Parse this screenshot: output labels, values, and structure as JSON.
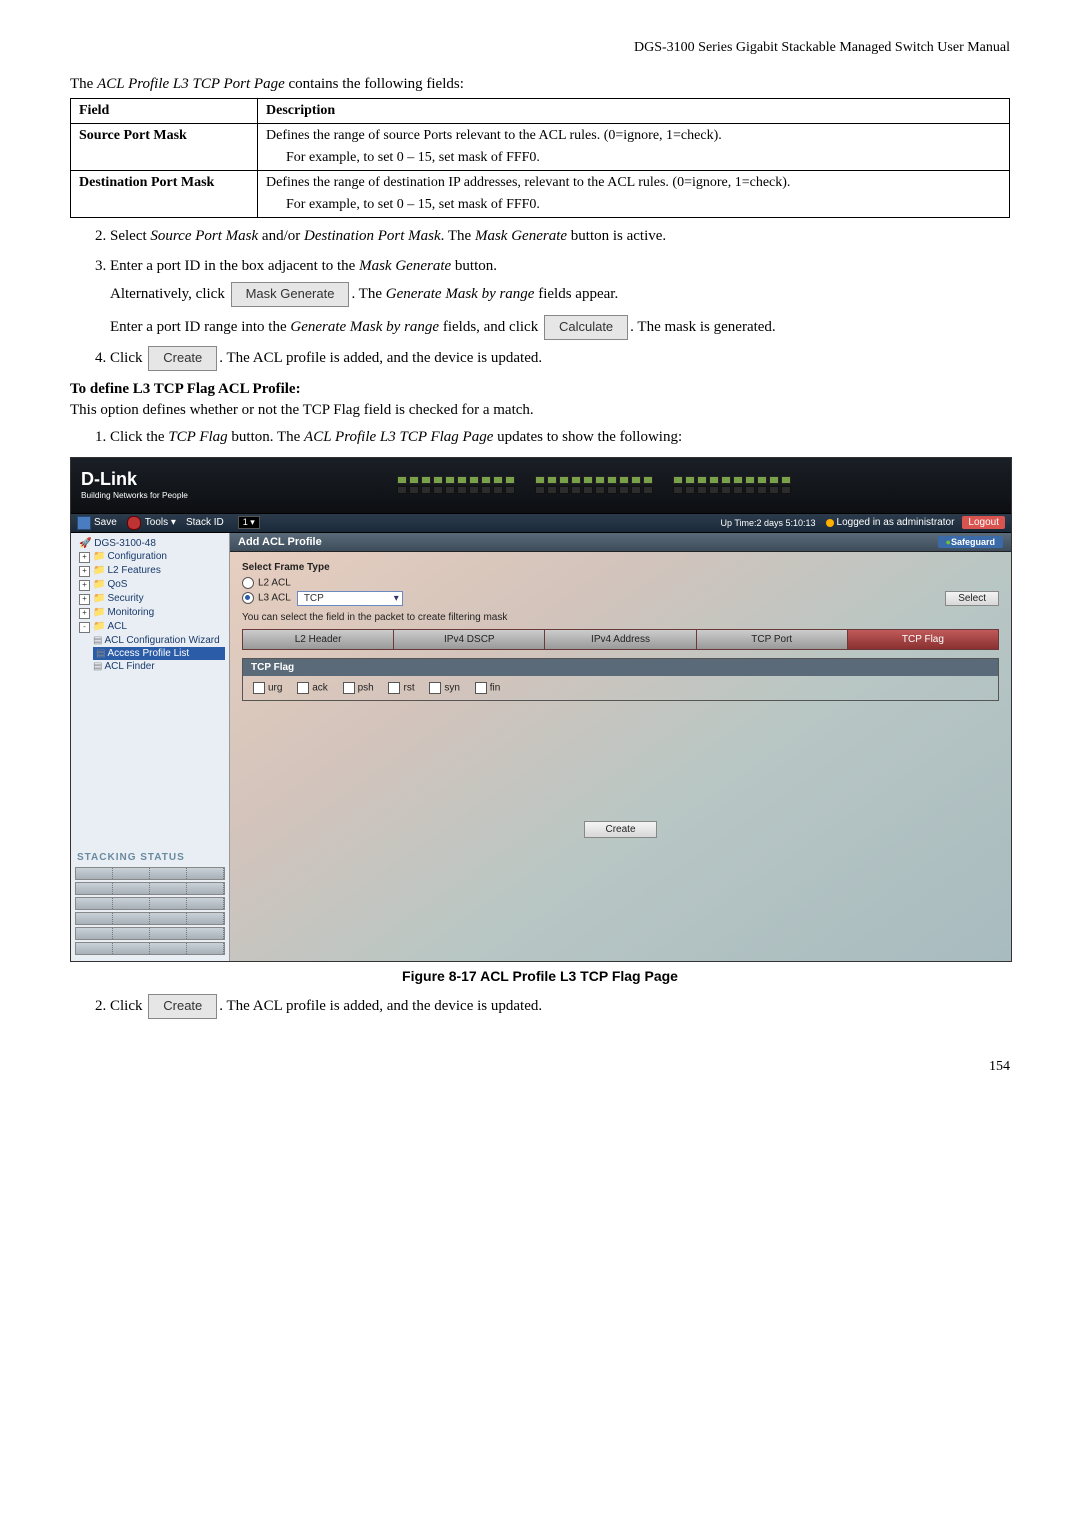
{
  "header": "DGS-3100 Series Gigabit Stackable Managed Switch User Manual",
  "intro_prefix": "The ",
  "intro_italic": "ACL Profile L3 TCP Port Page",
  "intro_suffix": " contains the following fields:",
  "table": {
    "h1": "Field",
    "h2": "Description",
    "r1c1": "Source Port Mask",
    "r1c2a": "Defines the range of source Ports relevant to the ACL rules. (0=ignore, 1=check).",
    "r1c2b": "For example, to set 0 – 15, set mask of FFF0.",
    "r2c1": "Destination Port Mask",
    "r2c2a": "Defines the range of destination IP addresses, relevant to the ACL rules. (0=ignore, 1=check).",
    "r2c2b": "For example, to set 0 – 15, set mask of FFF0."
  },
  "steps_a": {
    "s2a": "Select ",
    "s2b": "Source Port Mask",
    "s2c": " and/or ",
    "s2d": "Destination Port Mask",
    "s2e": ". The ",
    "s2f": "Mask Generate",
    "s2g": " button is active.",
    "s3a": "Enter a port ID in the box adjacent to the ",
    "s3b": "Mask Generate",
    "s3c": " button.",
    "s3alt_a": "Alternatively, click ",
    "s3alt_btn": "Mask Generate",
    "s3alt_b": ". The ",
    "s3alt_c": "Generate Mask by range",
    "s3alt_d": " fields appear.",
    "s3r_a": "Enter a port ID range into the ",
    "s3r_b": "Generate Mask by range",
    "s3r_c": " fields, and click ",
    "s3r_btn": "Calculate",
    "s3r_d": ". The mask is generated.",
    "s4a": "Click ",
    "s4btn": "Create",
    "s4b": ". The ACL profile is added, and the device is updated."
  },
  "section_heading": "To define L3 TCP Flag ACL Profile:",
  "section_text": "This option defines whether or not the TCP Flag field is checked for a match.",
  "steps_b": {
    "s1a": "Click the ",
    "s1b": "TCP Flag",
    "s1c": " button. The ",
    "s1d": "ACL Profile L3 TCP Flag Page",
    "s1e": " updates to show the following:"
  },
  "figure_caption": "Figure 8-17 ACL Profile L3 TCP Flag Page",
  "steps_c": {
    "s2a": "Click ",
    "s2btn": "Create",
    "s2b": ". The ACL profile is added, and the device is updated."
  },
  "page_number": "154",
  "ss": {
    "logo": "D-Link",
    "tagline": "Building Networks for People",
    "menubar": {
      "save": "Save",
      "tools": "Tools",
      "stackid": "Stack ID",
      "stack_val": "1",
      "uptime": "Up Time:2 days 5:10:13",
      "logged": "Logged in as administrator",
      "logout": "Logout"
    },
    "tree": {
      "root": "DGS-3100-48",
      "config": "Configuration",
      "l2": "L2 Features",
      "qos": "QoS",
      "security": "Security",
      "monitoring": "Monitoring",
      "acl": "ACL",
      "acl_wiz": "ACL Configuration Wizard",
      "acl_profile": "Access Profile List",
      "acl_finder": "ACL Finder"
    },
    "stacking_title": "STACKING STATUS",
    "panel": {
      "title": "Add ACL Profile",
      "safeguard": "Safeguard",
      "frame_label": "Select Frame Type",
      "l2": "L2 ACL",
      "l3": "L3 ACL",
      "l3_proto": "TCP",
      "select_btn": "Select",
      "hint": "You can select the field in the packet to create filtering mask",
      "tab1": "L2 Header",
      "tab2": "IPv4 DSCP",
      "tab3": "IPv4 Address",
      "tab4": "TCP Port",
      "tab5": "TCP Flag",
      "tcpflag": "TCP Flag",
      "f_urg": "urg",
      "f_ack": "ack",
      "f_psh": "psh",
      "f_rst": "rst",
      "f_syn": "syn",
      "f_fin": "fin",
      "create": "Create"
    }
  }
}
